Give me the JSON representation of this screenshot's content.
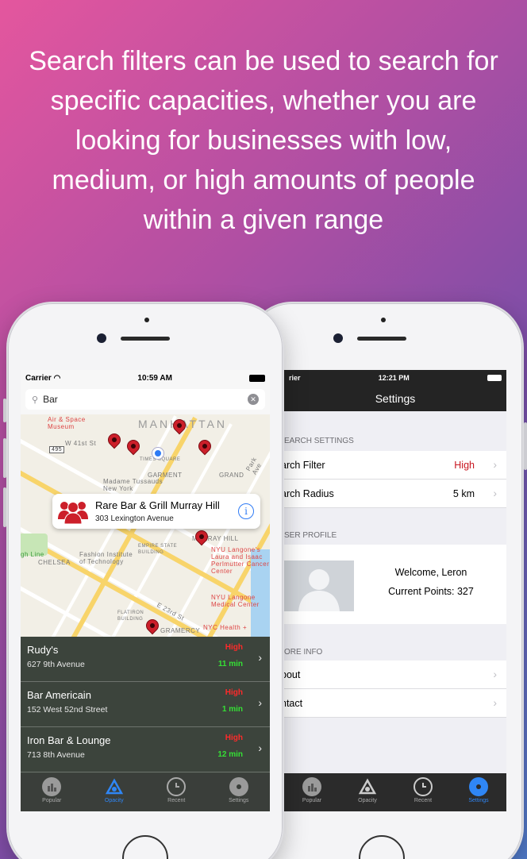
{
  "headline": "Search filters can be used to search for specific capacities, whether you are looking for businesses with low, medium, or high amounts of people within a given range",
  "left_phone": {
    "status": {
      "carrier": "Carrier",
      "time": "10:59 AM"
    },
    "search": {
      "value": "Bar"
    },
    "map_labels": {
      "manhattan": "MANHATTAN",
      "air_space": "Air & Space Museum",
      "w41": "W 41st St",
      "times_square": "TIMES SQUARE",
      "garment": "GARMENT",
      "new_york": "New York",
      "tussauds": "Madame Tussauds New York",
      "grand": "GRAND",
      "park_ave": "Park Ave",
      "fashion": "Fashion Institute of Technology",
      "chelsea": "CHELSEA",
      "empire": "EMPIRE STATE BUILDING",
      "murray_hill": "MURRAY HILL",
      "nyu_langone": "NYU Langone's Laura and Isaac Perlmutter Cancer Center",
      "nyu_medical": "NYU Langone Medical Center",
      "flatiron": "FLATIRON BUILDING",
      "e23": "E 23rd St",
      "gramercy": "GRAMERCY",
      "nyc_health": "NYC Health +",
      "high_line": "gh Line",
      "route_495": "495"
    },
    "callout": {
      "title": "Rare Bar & Grill Murray Hill",
      "address": "303 Lexington Avenue"
    },
    "results": [
      {
        "name": "Rudy's",
        "address": "627 9th Avenue",
        "capacity": "High",
        "time": "11 min"
      },
      {
        "name": "Bar Americain",
        "address": "152 West 52nd Street",
        "capacity": "High",
        "time": "1 min"
      },
      {
        "name": "Iron Bar & Lounge",
        "address": "713 8th Avenue",
        "capacity": "High",
        "time": "12 min"
      }
    ],
    "tabs": {
      "popular": "Popular",
      "opacity": "Opacity",
      "recent": "Recent",
      "settings": "Settings"
    }
  },
  "right_phone": {
    "status": {
      "carrier": "rier",
      "time": "12:21 PM"
    },
    "title": "Settings",
    "search_header": "EARCH SETTINGS",
    "search_filter": {
      "label": "arch Filter",
      "value": "High"
    },
    "search_radius": {
      "label": "arch Radius",
      "value": "5 km"
    },
    "profile_header": "SER PROFILE",
    "welcome": "Welcome, Leron",
    "points": "Current Points: 327",
    "more_header": "ORE INFO",
    "about": "bout",
    "contact": "ntact",
    "tabs": {
      "popular": "Popular",
      "opacity": "Opacity",
      "recent": "Recent",
      "settings": "Settings"
    }
  },
  "colors": {
    "accent_blue": "#2f86f5",
    "capacity_high": "#ff2a2a",
    "time_green": "#35e035",
    "pin_red": "#cc1f2a"
  },
  "icons": [
    "search-icon",
    "clear-icon",
    "wifi-icon",
    "battery-icon",
    "map-pin-icon",
    "people-icon",
    "info-icon",
    "chevron-right-icon",
    "popular-tab-icon",
    "opacity-tab-icon",
    "recent-tab-icon",
    "settings-tab-icon",
    "avatar-placeholder"
  ]
}
